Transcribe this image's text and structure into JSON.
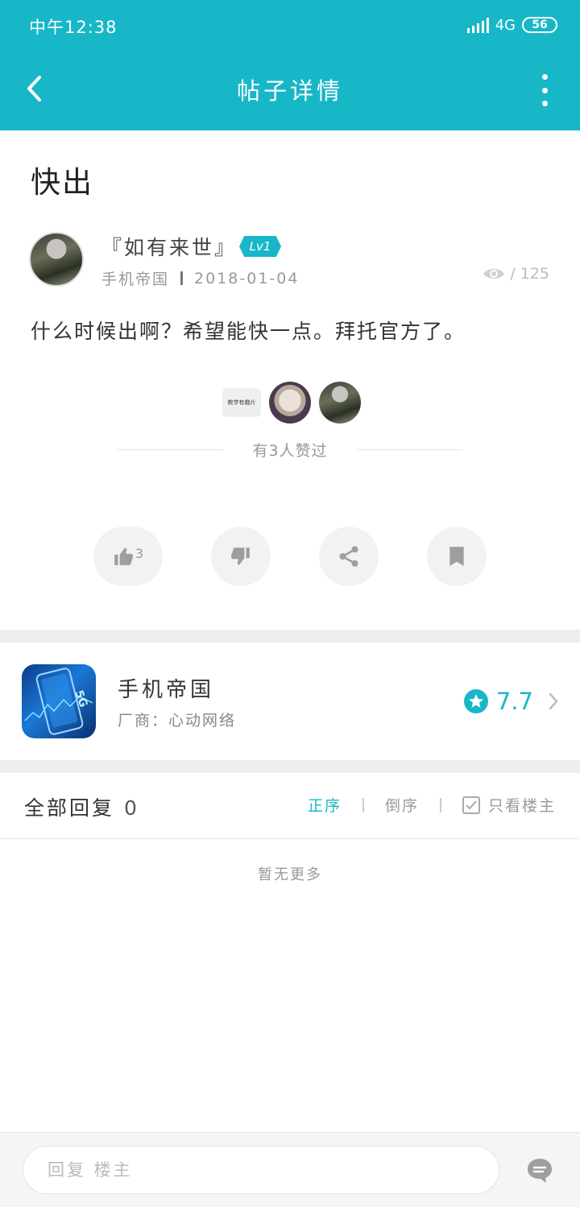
{
  "status_bar": {
    "time": "中午12:38",
    "network": "4G",
    "battery": "56"
  },
  "nav": {
    "title": "帖子详情"
  },
  "post": {
    "title": "快出",
    "author": "『如有来世』",
    "level": "Lv1",
    "app": "手机帝国",
    "date": "2018-01-04",
    "views": "125",
    "body": "什么时候出啊？希望能快一点。拜托官方了。"
  },
  "likers": {
    "first_label": "教学有趣片",
    "summary": "有3人赞过"
  },
  "actions": {
    "like_count": "3"
  },
  "app_card": {
    "name": "手机帝国",
    "vendor": "厂商：心动网络",
    "rating": "7.7"
  },
  "replies": {
    "title": "全部回复",
    "count": "0",
    "sort_asc": "正序",
    "sort_desc": "倒序",
    "only_op": "只看楼主"
  },
  "empty_text": "暂无更多",
  "footer": {
    "placeholder": "回复 楼主"
  },
  "colors": {
    "accent": "#17b7c8",
    "background": "#ffffff",
    "divider": "#eeeeee"
  }
}
